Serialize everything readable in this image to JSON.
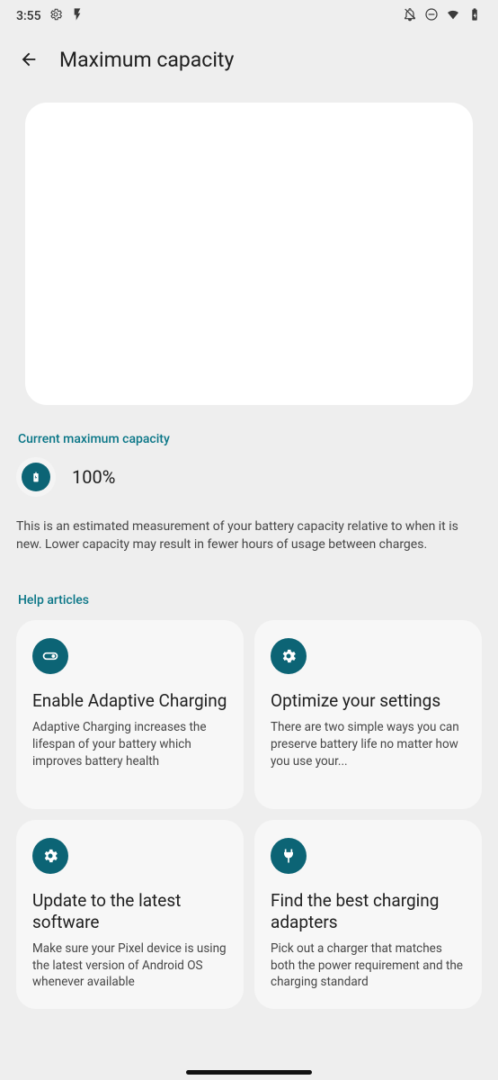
{
  "statusBar": {
    "time": "3:55"
  },
  "header": {
    "title": "Maximum capacity"
  },
  "capacity": {
    "sectionLabel": "Current maximum capacity",
    "value": "100%",
    "description": "This is an estimated measurement of your battery capacity relative to when it is new. Lower capacity may result in fewer hours of usage between charges."
  },
  "help": {
    "sectionLabel": "Help articles",
    "cards": [
      {
        "title": "Enable Adaptive Charging",
        "desc": "Adaptive Charging increases the lifespan of your battery which improves battery health"
      },
      {
        "title": "Optimize your settings",
        "desc": "There are two simple ways you can preserve battery life no matter how you use your..."
      },
      {
        "title": "Update to the latest software",
        "desc": "Make sure your Pixel device is using the latest version of Android OS whenever available"
      },
      {
        "title": "Find the best charging adapters",
        "desc": "Pick out a charger that matches both the power requirement and the charging standard"
      }
    ]
  }
}
